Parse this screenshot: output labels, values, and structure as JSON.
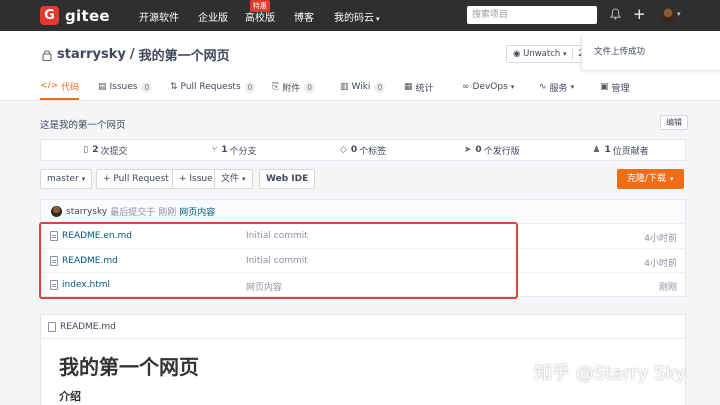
{
  "topnav": {
    "logo_letter": "G",
    "logo_text": "gitee",
    "items": [
      "开源软件",
      "企业版",
      "高校版",
      "博客",
      "我的码云"
    ],
    "hot_badge": "特惠",
    "search_placeholder": "搜索项目",
    "plus": "+"
  },
  "repo": {
    "owner": "starrysky",
    "separator": "/",
    "name": "我的第一个网页",
    "unwatch_label": "Unwatch",
    "unwatch_count": "2",
    "toast": "文件上传成功"
  },
  "tabs": [
    {
      "label": "代码",
      "icon": "</>"
    },
    {
      "label": "Issues",
      "count": "0"
    },
    {
      "label": "Pull Requests",
      "count": "0"
    },
    {
      "label": "附件",
      "count": "0"
    },
    {
      "label": "Wiki",
      "count": "0"
    },
    {
      "label": "统计"
    },
    {
      "label": "DevOps"
    },
    {
      "label": "服务"
    },
    {
      "label": "管理"
    }
  ],
  "description": "这是我的第一个网页",
  "edit_label": "编辑",
  "stats": [
    {
      "num": "2",
      "label": "次提交"
    },
    {
      "num": "1",
      "label": "个分支"
    },
    {
      "num": "0",
      "label": "个标签"
    },
    {
      "num": "0",
      "label": "个发行版"
    },
    {
      "num": "1",
      "label": "位贡献者"
    }
  ],
  "toolbar": {
    "branch": "master",
    "pull_request": "+ Pull Request",
    "issue": "+ Issue",
    "file": "文件",
    "webide": "Web IDE",
    "clone": "克隆/下载"
  },
  "commit": {
    "author": "starrysky",
    "text": "最后提交于",
    "time": "刚刚",
    "message": "网页内容"
  },
  "files": [
    {
      "name": "README.en.md",
      "message": "Initial commit",
      "time": "4小时前"
    },
    {
      "name": "README.md",
      "message": "Initial commit",
      "time": "4小时前"
    },
    {
      "name": "index.html",
      "message": "网页内容",
      "time": "刚刚"
    }
  ],
  "readme": {
    "filename": "README.md",
    "h1": "我的第一个网页",
    "h2": "介绍"
  },
  "watermark": "知乎 @Starry Sky",
  "colors": {
    "accent": "#f06d16",
    "brand": "#e23a2e",
    "link": "#005980",
    "highlight": "#e04040"
  }
}
